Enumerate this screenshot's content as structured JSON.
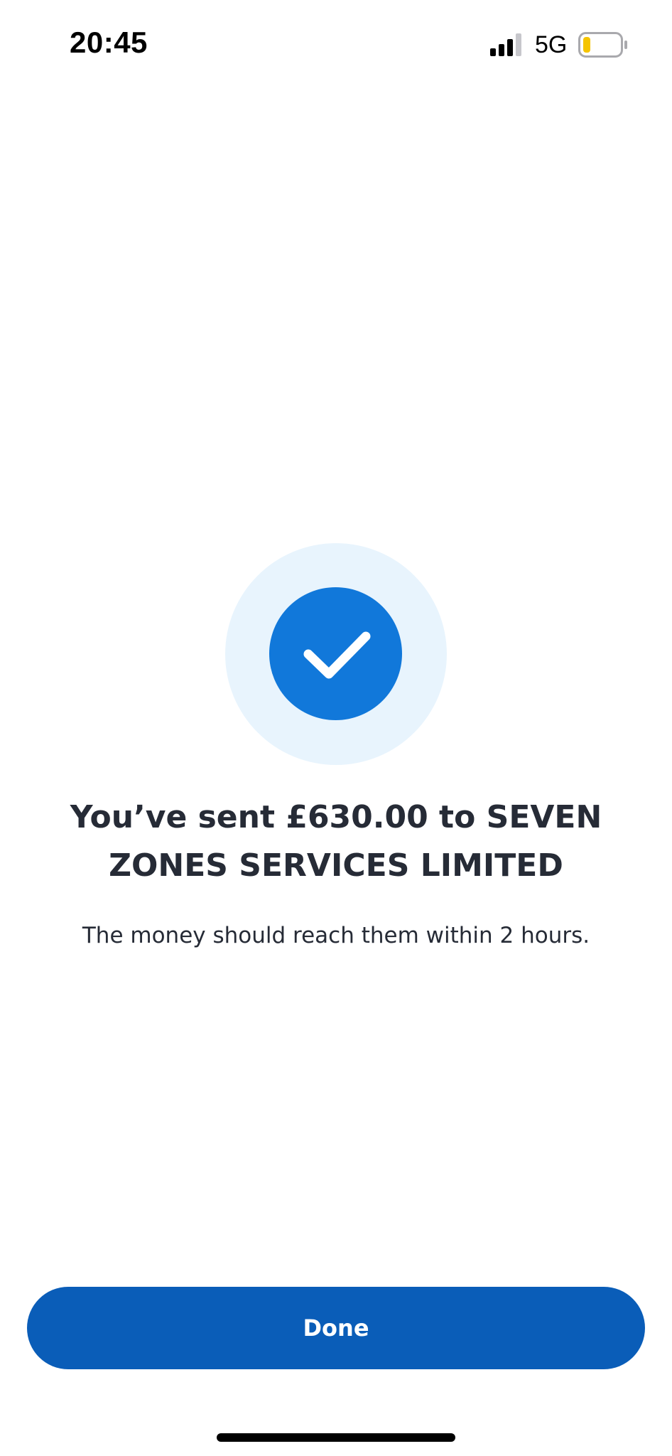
{
  "status_bar": {
    "time": "20:45",
    "network": "5G",
    "signal_icon": "cellular-signal-icon",
    "battery_icon": "battery-low-icon",
    "battery_level_fraction": 0.15,
    "battery_color": "#f5c400"
  },
  "success": {
    "icon": "checkmark-icon",
    "accent_color": "#1178da",
    "halo_color": "#e8f4fd",
    "headline": "You’ve sent £630.00 to SEVEN ZONES SERVICES LIMITED",
    "message": "The money should reach them within 2 hours."
  },
  "actions": {
    "done_label": "Done",
    "button_color": "#0a5db8"
  }
}
